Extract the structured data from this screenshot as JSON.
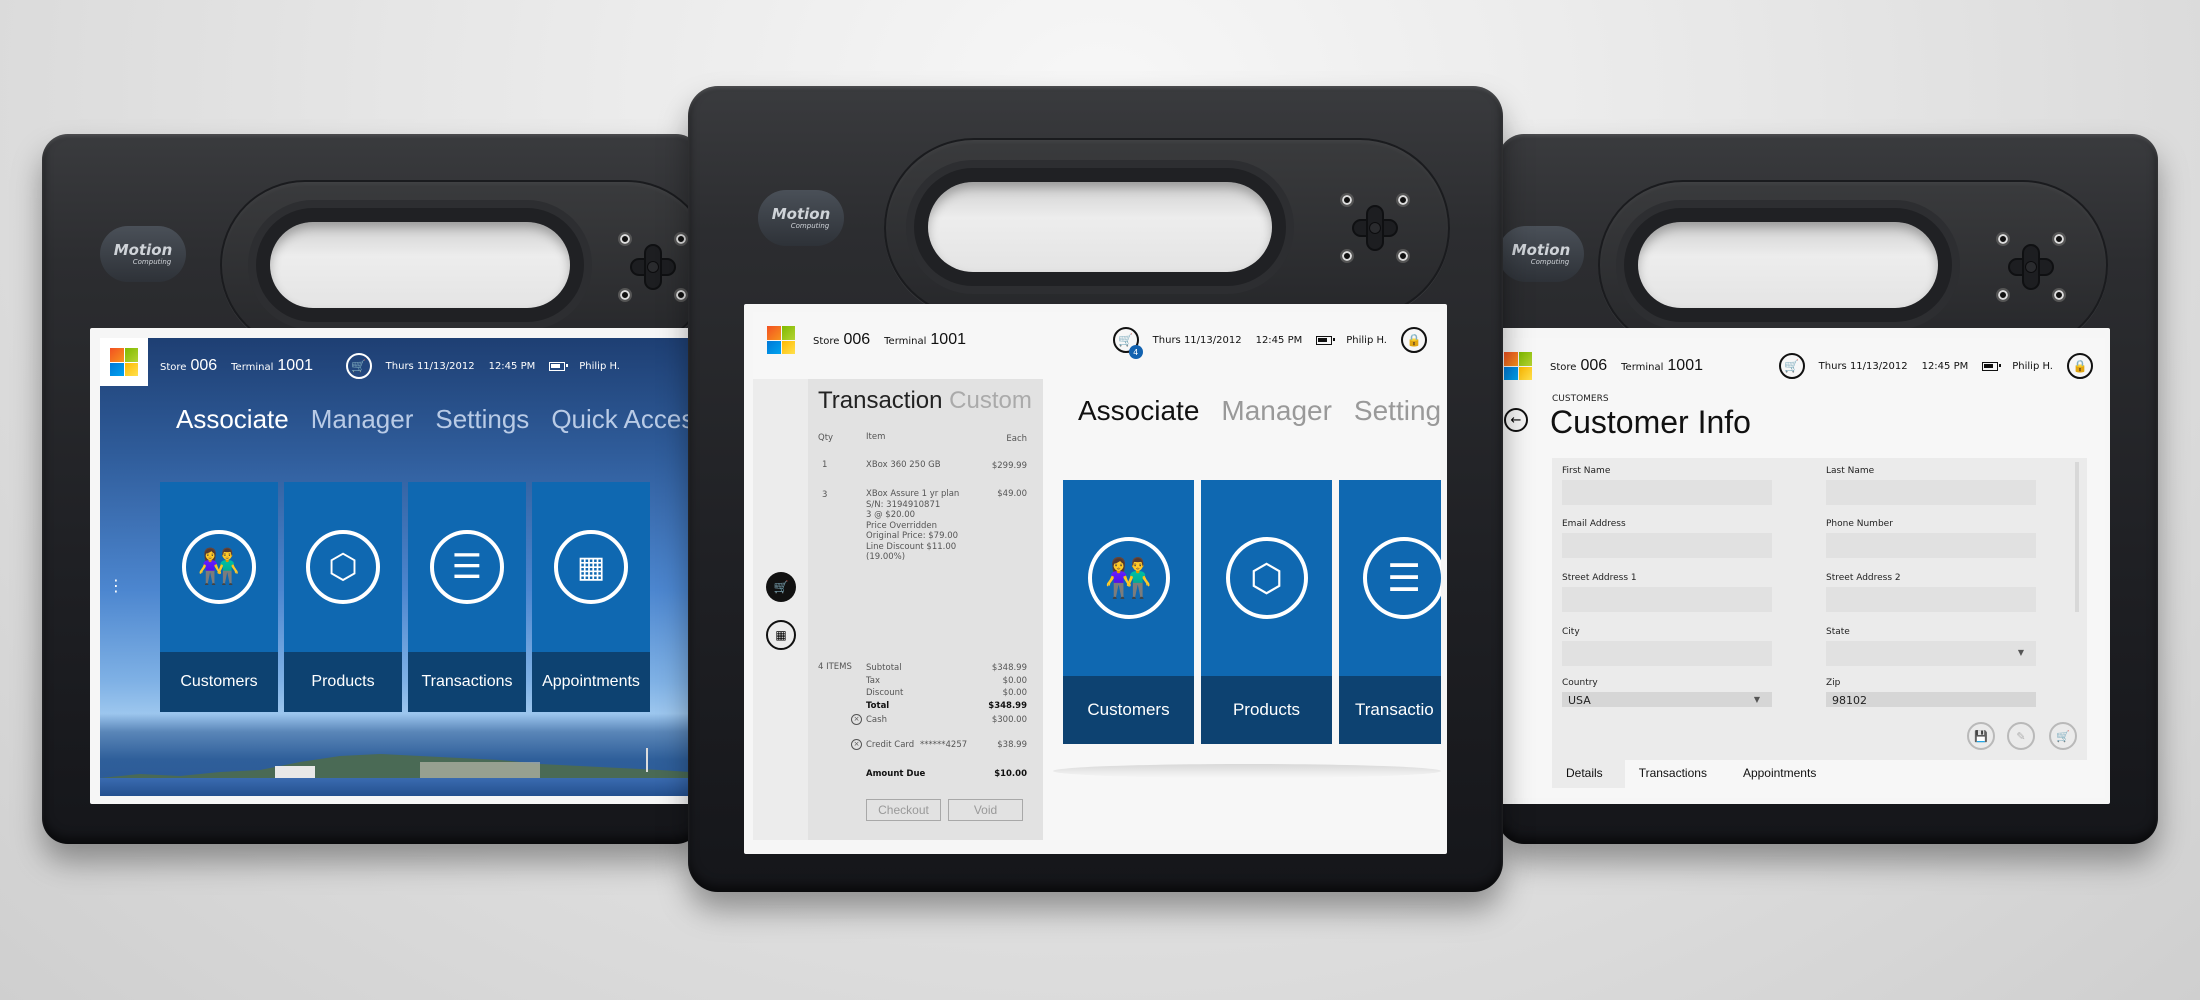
{
  "scene": {
    "description": "Three Motion Computing rugged tablets showing a Microsoft retail POS app",
    "device_brand": "Motion",
    "device_brand_sub": "Computing"
  },
  "header": {
    "store_label": "Store",
    "store_value": "006",
    "terminal_label": "Terminal",
    "terminal_value": "1001",
    "date": "Thurs 11/13/2012",
    "time": "12:45 PM",
    "user": "Philip H.",
    "cart_count": "4",
    "icons": {
      "logo": "microsoft-logo-icon",
      "cart": "shopping-cart-icon",
      "battery": "battery-icon",
      "lock": "lock-icon"
    }
  },
  "left_screen": {
    "pivots": [
      "Associate",
      "Manager",
      "Settings",
      "Quick Access"
    ],
    "active_pivot": "Associate",
    "tiles": [
      {
        "label": "Customers",
        "icon": "people-icon"
      },
      {
        "label": "Products",
        "icon": "box-icon"
      },
      {
        "label": "Transactions",
        "icon": "list-icon"
      },
      {
        "label": "Appointments",
        "icon": "calendar-icon"
      }
    ],
    "side_handle": "⋮"
  },
  "center_screen": {
    "panel_pivots": [
      "Transaction",
      "Custom"
    ],
    "pivots": [
      "Associate",
      "Manager",
      "Settings"
    ],
    "tiles": [
      {
        "label": "Customers",
        "icon": "people-icon"
      },
      {
        "label": "Products",
        "icon": "box-icon"
      },
      {
        "label": "Transactio",
        "icon": "list-icon"
      }
    ],
    "transaction": {
      "columns": {
        "qty": "Qty",
        "item": "Item",
        "each": "Each"
      },
      "lines": [
        {
          "qty": "1",
          "item": [
            "XBox 360 250 GB"
          ],
          "each": "$299.99"
        },
        {
          "qty": "3",
          "item": [
            "XBox Assure 1 yr plan",
            "S/N: 3194910871",
            "3 @ $20.00",
            "Price Overridden",
            "Original Price: $79.00",
            "Line Discount $11.00",
            "(19.00%)"
          ],
          "each": "$49.00"
        }
      ],
      "item_count": "4 ITEMS",
      "subtotal_label": "Subtotal",
      "subtotal": "$348.99",
      "tax_label": "Tax",
      "tax": "$0.00",
      "discount_label": "Discount",
      "discount": "$0.00",
      "total_label": "Total",
      "total": "$348.99",
      "payments": [
        {
          "label": "Cash",
          "card": "",
          "amount": "$300.00"
        },
        {
          "label": "Credit Card",
          "card": "******4257",
          "amount": "$38.99"
        }
      ],
      "amount_due_label": "Amount Due",
      "amount_due": "$10.00",
      "checkout_label": "Checkout",
      "void_label": "Void"
    },
    "rail_icons": [
      "shopping-cart-icon",
      "calculator-icon"
    ]
  },
  "right_screen": {
    "breadcrumb": "CUSTOMERS",
    "title": "Customer Info",
    "fields": [
      {
        "label": "First Name",
        "value": "",
        "type": "text"
      },
      {
        "label": "Last Name",
        "value": "",
        "type": "text"
      },
      {
        "label": "Email Address",
        "value": "",
        "type": "text"
      },
      {
        "label": "Phone Number",
        "value": "",
        "type": "text"
      },
      {
        "label": "Street Address 1",
        "value": "",
        "type": "text"
      },
      {
        "label": "Street Address 2",
        "value": "",
        "type": "text"
      },
      {
        "label": "City",
        "value": "",
        "type": "text"
      },
      {
        "label": "State",
        "value": "",
        "type": "select"
      },
      {
        "label": "Country",
        "value": "USA",
        "type": "select"
      },
      {
        "label": "Zip",
        "value": "98102",
        "type": "text"
      }
    ],
    "actions": [
      "save-icon",
      "edit-icon",
      "add-to-cart-icon"
    ],
    "tabs": [
      "Details",
      "Transactions",
      "Appointments"
    ],
    "active_tab": "Details"
  }
}
